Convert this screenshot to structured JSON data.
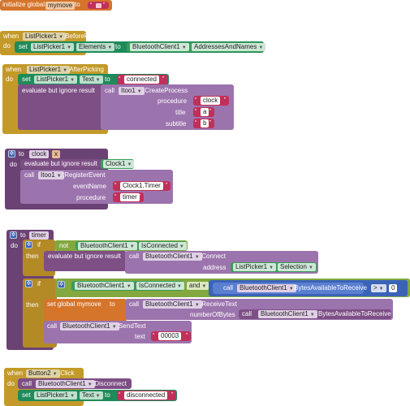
{
  "b1": {
    "init": "initialize global",
    "var": "mymove",
    "to": "to"
  },
  "b2": {
    "when": "when",
    "comp": "ListPicker1",
    "event": ".BeforePicking",
    "do": "do",
    "set": "set",
    "prop": "Elements",
    "to": "to",
    "bt": "BluetoothClient1",
    "bprop": "AddressesAndNames"
  },
  "b3": {
    "when": "when",
    "comp": "ListPicker1",
    "event": ".AfterPicking",
    "do": "do",
    "set": "set",
    "prop": "Text",
    "to": "to",
    "connected": "connected",
    "eval": "evaluate but ignore result",
    "call": "call",
    "itoo": "Itoo1",
    "method": ".CreateProcess",
    "procedure": "procedure",
    "clock": "clock",
    "title": "title",
    "a": "a",
    "subtitle": "subtitle",
    "b": "b"
  },
  "b4": {
    "to": "to",
    "name": "clock",
    "x": "x",
    "do": "do",
    "eval": "evaluate but ignore result",
    "clock1": "Clock1",
    "call": "call",
    "itoo": "Itoo1",
    "method": ".RegisterEvent",
    "eventName": "eventName",
    "eventVal": "Clock1.Timer",
    "procedure": "procedure",
    "procVal": "timer"
  },
  "b5": {
    "to": "to",
    "name": "timer",
    "do": "do",
    "if": "if",
    "not": "not",
    "bt": "BluetoothClient1",
    "isConnected": "IsConnected",
    "then": "then",
    "eval": "evaluate but ignore result",
    "call": "call",
    "connect": ".Connect",
    "address": "address",
    "lp": "ListPicker1",
    "selection": "Selection",
    "and": "and",
    "bytesAvail": ".BytesAvailableToReceive",
    "gt": ">",
    "zero": "0",
    "setg": "set global mymove",
    "to2": "to",
    "receive": ".ReceiveText",
    "numBytes": "numberOfBytes",
    "bytesAvail2": "BytesAvailableToReceive",
    "sendText": ".SendText",
    "text": "text",
    "textVal": "00003"
  },
  "b6": {
    "when": "when",
    "comp": "Button2",
    "event": ".Click",
    "do": "do",
    "call": "call",
    "bt": "BluetoothClient1",
    "disconnect": ".Disconnect",
    "set": "set",
    "lp": "ListPicker1",
    "prop": "Text",
    "to": "to",
    "disconnected": "disconnected"
  }
}
